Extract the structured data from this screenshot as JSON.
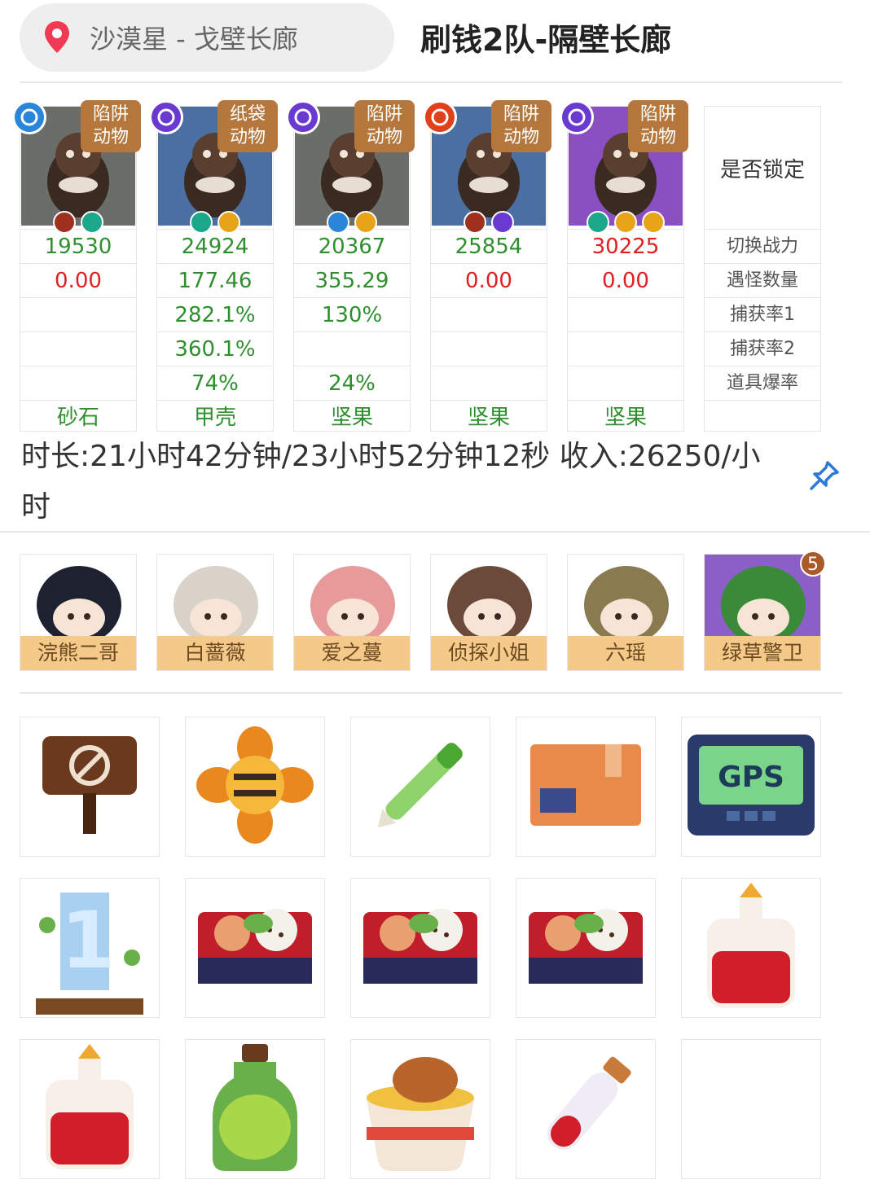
{
  "header": {
    "location": "沙漠星 - 戈壁长廊",
    "team_name": "刷钱2队-隔壁长廊"
  },
  "pets": [
    {
      "element": "water",
      "element_color": "#2a86d8",
      "tag": [
        "陷阱",
        "动物"
      ],
      "skills": [
        "#a0301e",
        "#1aa78a"
      ],
      "power": "19530",
      "power_color": "green",
      "encounters": "0.00",
      "encounters_color": "red",
      "capture1": "",
      "capture2": "",
      "drop_rate": "",
      "bait": "砂石",
      "bg": "#6b6e68"
    },
    {
      "element": "dark",
      "element_color": "#6a3ad0",
      "tag": [
        "纸袋",
        "动物"
      ],
      "skills": [
        "#1aa78a",
        "#e8a419"
      ],
      "power": "24924",
      "power_color": "green",
      "encounters": "177.46",
      "encounters_color": "green",
      "capture1": "282.1%",
      "capture2": "360.1%",
      "drop_rate": "74%",
      "bait": "甲壳",
      "bg": "#4a6fa0"
    },
    {
      "element": "dark",
      "element_color": "#6a3ad0",
      "tag": [
        "陷阱",
        "动物"
      ],
      "skills": [
        "#2a86d8",
        "#e8a419"
      ],
      "power": "20367",
      "power_color": "green",
      "encounters": "355.29",
      "encounters_color": "green",
      "capture1": "130%",
      "capture2": "",
      "drop_rate": "24%",
      "bait": "坚果",
      "bg": "#6b6e68"
    },
    {
      "element": "fire",
      "element_color": "#e0401a",
      "tag": [
        "陷阱",
        "动物"
      ],
      "skills": [
        "#a0301e",
        "#6a3ad0"
      ],
      "power": "25854",
      "power_color": "green",
      "encounters": "0.00",
      "encounters_color": "red",
      "capture1": "",
      "capture2": "",
      "drop_rate": "",
      "bait": "坚果",
      "bg": "#4a6fa0"
    },
    {
      "element": "dark",
      "element_color": "#6a3ad0",
      "tag": [
        "陷阱",
        "动物"
      ],
      "skills": [
        "#1aa78a",
        "#e8a419",
        "#e8a419"
      ],
      "power": "30225",
      "power_color": "red",
      "encounters": "0.00",
      "encounters_color": "red",
      "capture1": "",
      "capture2": "",
      "drop_rate": "",
      "bait": "坚果",
      "bg": "#8a4fc0"
    }
  ],
  "labels": {
    "lock": "是否锁定",
    "switch_power": "切换战力",
    "encounters": "遇怪数量",
    "capture1": "捕获率1",
    "capture2": "捕获率2",
    "drop_rate": "道具爆率"
  },
  "duration_text": "时长:21小时42分钟/23小时52分钟12秒 收入:26250/小时",
  "characters": [
    {
      "name": "浣熊二哥",
      "bg": "#ffffff",
      "color": "#1e2230"
    },
    {
      "name": "白蔷薇",
      "bg": "#ffffff",
      "color": "#d8d2c8"
    },
    {
      "name": "爱之蔓",
      "bg": "#ffffff",
      "color": "#e89a9a"
    },
    {
      "name": "侦探小姐",
      "bg": "#ffffff",
      "color": "#6b4a3a"
    },
    {
      "name": "六瑶",
      "bg": "#ffffff",
      "color": "#8a7a50"
    },
    {
      "name": "绿草警卫",
      "bg": "#8a5fc8",
      "color": "#3a8a3a"
    }
  ],
  "character_badge": "5",
  "items": [
    "no-sign-icon",
    "honeycomb-flower-icon",
    "pen-icon",
    "parcel-box-icon",
    "gps-device-icon",
    "trophy-1-icon",
    "bento-box-icon",
    "bento-box-icon",
    "bento-box-icon",
    "red-potion-icon",
    "red-potion-icon",
    "green-potion-icon",
    "fried-chicken-bowl-icon",
    "test-tube-icon",
    "empty-slot"
  ]
}
